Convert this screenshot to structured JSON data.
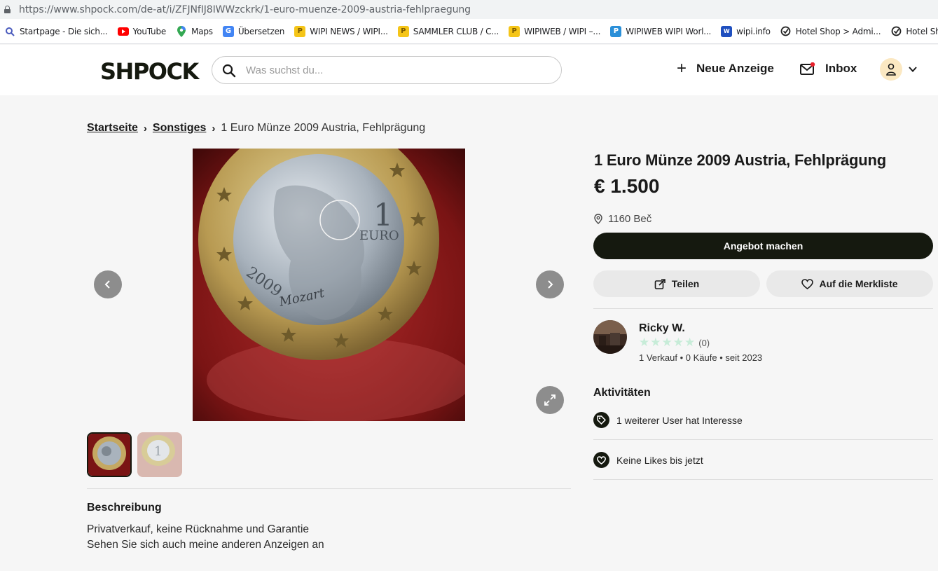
{
  "browser": {
    "url": "https://www.shpock.com/de-at/i/ZFJNfIJ8IWWzckrk/1-euro-muenze-2009-austria-fehlpraegung",
    "bookmarks": [
      {
        "label": "Startpage - Die sich...",
        "icon": "startpage-icon"
      },
      {
        "label": "YouTube",
        "icon": "youtube-icon"
      },
      {
        "label": "Maps",
        "icon": "maps-icon"
      },
      {
        "label": "Übersetzen",
        "icon": "translate-icon"
      },
      {
        "label": "WIPI NEWS / WIPI...",
        "icon": "wipi-icon"
      },
      {
        "label": "SAMMLER CLUB / C...",
        "icon": "wipi-icon"
      },
      {
        "label": "WIPIWEB / WIPI –...",
        "icon": "wipi-icon"
      },
      {
        "label": "WIPIWEB WIPI Worl...",
        "icon": "wipi-blue-icon"
      },
      {
        "label": "wipi.info",
        "icon": "wipi-info-icon"
      },
      {
        "label": "Hotel Shop > Admi...",
        "icon": "hotel-shop-icon"
      },
      {
        "label": "Hotel Shop",
        "icon": "hotel-shop-icon"
      }
    ]
  },
  "header": {
    "logo": "SHPOCK",
    "search_placeholder": "Was suchst du...",
    "new_ad_label": "Neue Anzeige",
    "inbox_label": "Inbox"
  },
  "breadcrumb": {
    "home": "Startseite",
    "category": "Sonstiges",
    "current": "1 Euro Münze 2009 Austria, Fehlprägung"
  },
  "listing": {
    "title": "1 Euro Münze 2009 Austria, Fehlprägung",
    "price": "€ 1.500",
    "location": "1160 Beč",
    "offer_button": "Angebot machen",
    "share_button": "Teilen",
    "watchlist_button": "Auf die Merkliste"
  },
  "seller": {
    "name": "Ricky W.",
    "rating_count": "(0)",
    "sales": "1 Verkauf",
    "purchases": "0 Käufe",
    "since": "seit 2023",
    "separator": "•"
  },
  "activities": {
    "heading": "Aktivitäten",
    "interest": "1 weiterer User hat Interesse",
    "likes": "Keine Likes bis jetzt"
  },
  "description": {
    "heading": "Beschreibung",
    "line1": "Privatverkauf, keine Rücknahme und Garantie",
    "line2": "Sehen Sie sich auch meine anderen Anzeigen an"
  },
  "coin": {
    "year": "2009",
    "denomination": "1",
    "currency": "EURO",
    "signature": "Mozart"
  },
  "colors": {
    "brand_dark": "#15190f",
    "button_light": "#e9e9e9",
    "star_empty": "#c7ecd8",
    "notification_dot": "#e8202a"
  }
}
